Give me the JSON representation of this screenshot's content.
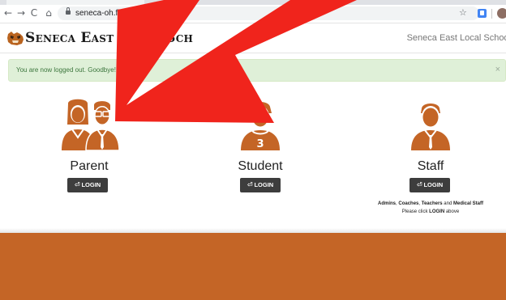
{
  "browser": {
    "url": "seneca-oh.finalforms.com",
    "back_glyph": "←",
    "forward_glyph": "→",
    "reload_glyph": "C",
    "home_glyph": "⌂",
    "star_glyph": "☆"
  },
  "header": {
    "title": "Seneca East Local Sch",
    "right_text": "Seneca East Local School"
  },
  "alert": {
    "message": "You are now logged out. Goodbye!",
    "close": "×"
  },
  "roles": [
    {
      "label": "Parent",
      "button": "LOGIN",
      "icon": "parent-couple-icon"
    },
    {
      "label": "Student",
      "button": "LOGIN",
      "icon": "student-icon",
      "jersey_number": "3"
    },
    {
      "label": "Staff",
      "button": "LOGIN",
      "icon": "staff-icon"
    }
  ],
  "staff_note": {
    "line1_a": "Admins",
    "line1_b": "Coaches",
    "line1_c": "Teachers",
    "line1_and": "and",
    "line1_d": "Medical Staff",
    "sep": ", ",
    "line2_pre": "Please click",
    "line2_bold": "LOGIN",
    "line2_post": "above"
  },
  "colors": {
    "brand_orange": "#c46526",
    "alert_bg": "#dff0d8",
    "alert_text": "#3c763d",
    "button_dark": "#3d3d3d",
    "overlay_arrow": "#f0241c"
  }
}
